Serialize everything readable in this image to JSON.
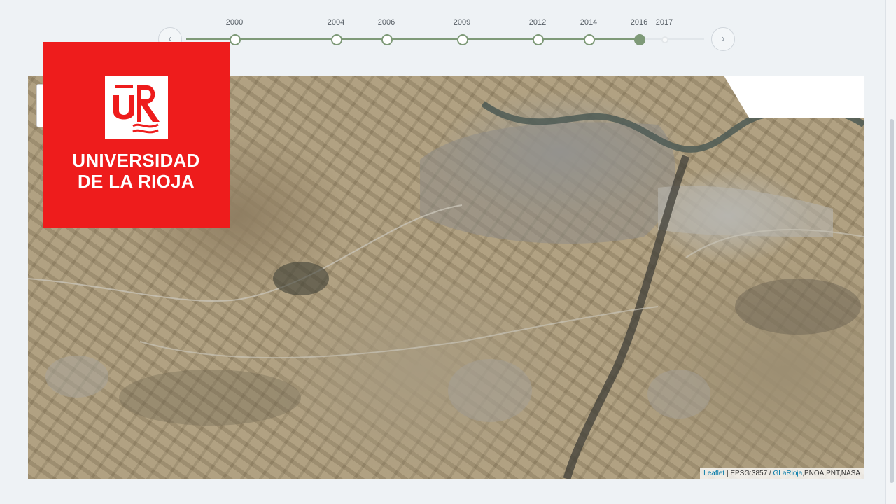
{
  "timeline": {
    "years": [
      {
        "label": "2000",
        "state": "past"
      },
      {
        "label": "2004",
        "state": "past"
      },
      {
        "label": "2006",
        "state": "past"
      },
      {
        "label": "2009",
        "state": "past"
      },
      {
        "label": "2012",
        "state": "past"
      },
      {
        "label": "2014",
        "state": "past"
      },
      {
        "label": "2016",
        "state": "active"
      },
      {
        "label": "2017",
        "state": "future"
      }
    ],
    "prev_icon": "chevron-left-icon",
    "next_icon": "chevron-right-icon",
    "accent_color": "#7e9a78"
  },
  "logo": {
    "line1": "UNIVERSIDAD",
    "line2": "DE LA RIOJA",
    "background_color": "#ee1c1c"
  },
  "map": {
    "attribution": {
      "leaflet": "Leaflet",
      "sep1": " | EPSG:3857 / ",
      "source": "GLaRioja",
      "rest": ",PNOA,PNT,NASA"
    }
  }
}
